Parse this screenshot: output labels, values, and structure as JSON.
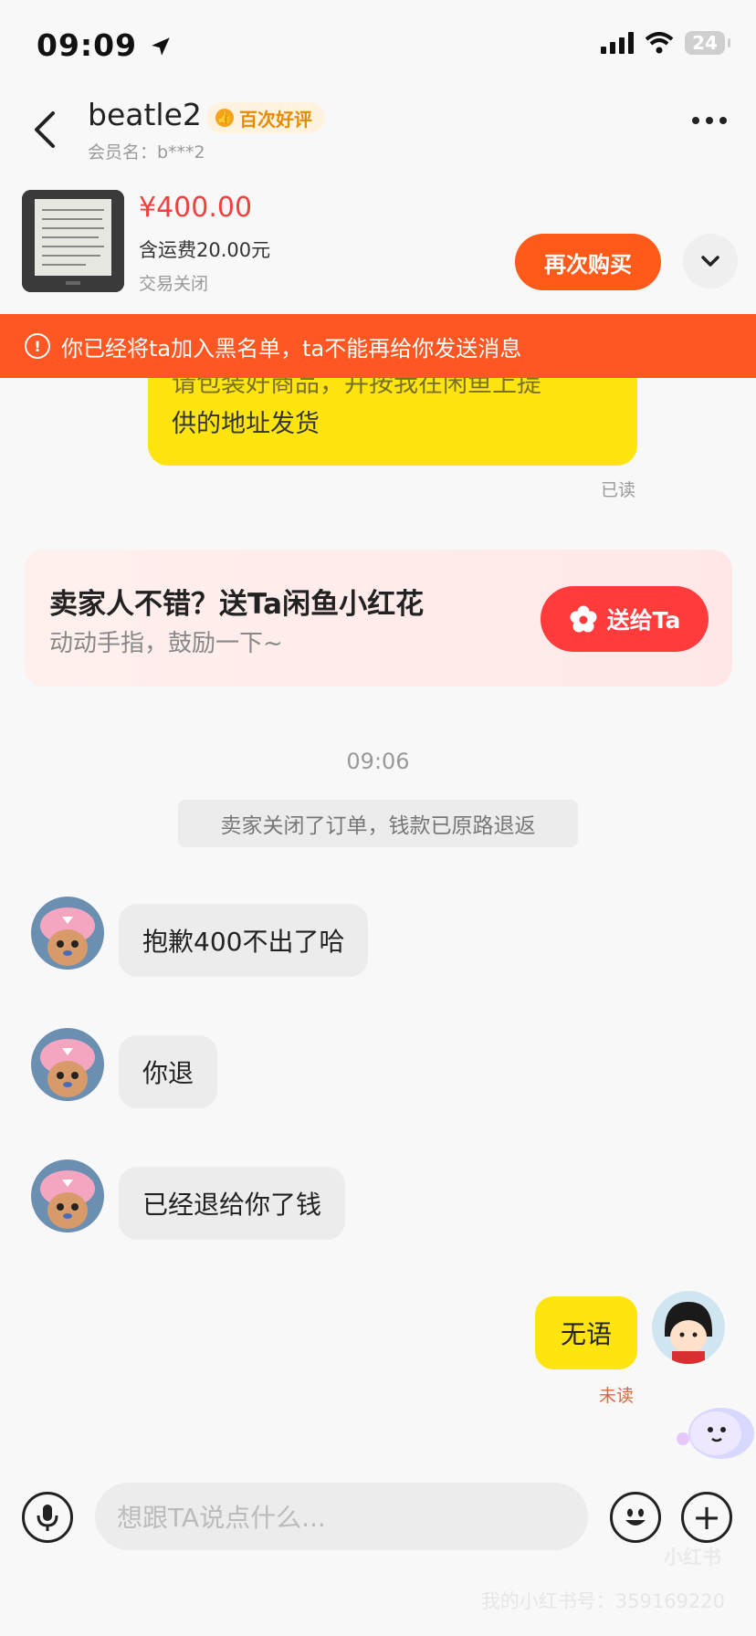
{
  "status_bar": {
    "time": "09:09",
    "battery": "24"
  },
  "header": {
    "title": "beatle2",
    "badge": "百次好评",
    "member_label": "会员名：b***2"
  },
  "product": {
    "price": "¥400.00",
    "shipping": "含运费20.00元",
    "status": "交易关闭",
    "rebuy_label": "再次购买"
  },
  "banner": {
    "text": "你已经将ta加入黑名单，ta不能再给你发送消息"
  },
  "partial_message": {
    "line1": "请包装好商品，并按我在闲鱼上提",
    "line2": "供的地址发货",
    "read": "已读"
  },
  "flower_card": {
    "title": "卖家人不错？送Ta闲鱼小红花",
    "subtitle": "动动手指，鼓励一下~",
    "button": "送给Ta"
  },
  "system": {
    "time": "09:06",
    "notice": "卖家关闭了订单，钱款已原路退返"
  },
  "messages": [
    {
      "side": "left",
      "text": "抱歉400不出了哈"
    },
    {
      "side": "left",
      "text": "你退"
    },
    {
      "side": "left",
      "text": "已经退给你了钱"
    },
    {
      "side": "right",
      "text": "无语",
      "status": "未读"
    }
  ],
  "input": {
    "placeholder": "想跟TA说点什么..."
  },
  "watermark": {
    "logo": "小红书",
    "id": "我的小红书号：359169220"
  },
  "colors": {
    "accent": "#ff5a19",
    "banner": "#ff5723",
    "bubble_self": "#ffe40f",
    "flower_button": "#ff3b3b"
  }
}
